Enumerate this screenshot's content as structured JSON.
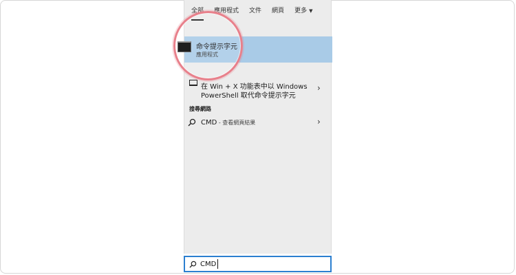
{
  "tabs": [
    {
      "label": "全部",
      "active": true
    },
    {
      "label": "應用程式",
      "active": false
    },
    {
      "label": "文件",
      "active": false
    },
    {
      "label": "網頁",
      "active": false
    },
    {
      "label": "更多",
      "active": false
    }
  ],
  "best_match": {
    "title": "命令提示字元",
    "subtitle": "應用程式",
    "icon": "command-prompt-icon"
  },
  "powershell_item": {
    "line1": "在 Win + X 功能表中以 Windows",
    "line2": "PowerShell 取代命令提示字元",
    "icon": "powershell-window-icon"
  },
  "web_section": {
    "label": "搜尋網路",
    "item_main": "CMD",
    "item_sub": " - 查看網頁結果",
    "icon": "search-icon"
  },
  "search": {
    "value": "CMD",
    "icon": "search-icon"
  },
  "colors": {
    "accent": "#2b7fd0",
    "selection": "#a9cbe7",
    "highlight_ring": "#e8808b"
  }
}
